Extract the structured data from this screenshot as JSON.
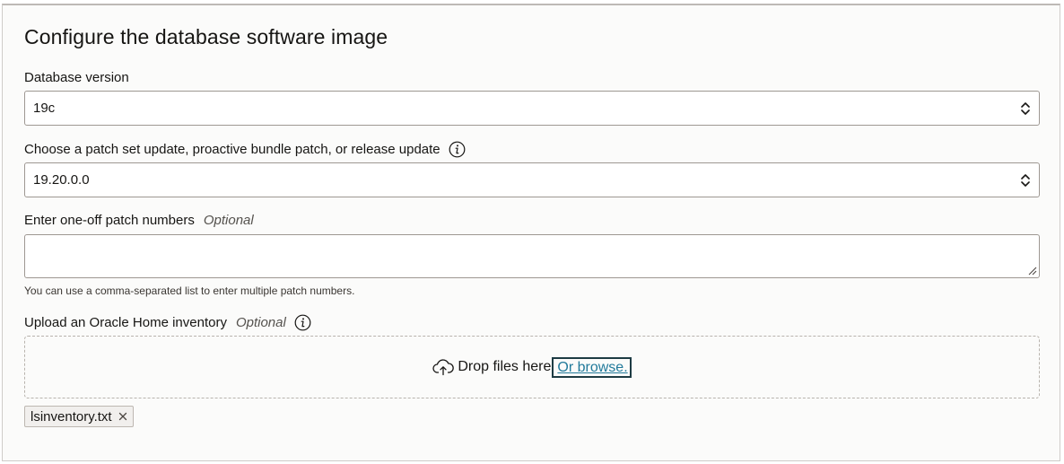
{
  "page": {
    "title": "Configure the database software image"
  },
  "fields": {
    "db_version": {
      "label": "Database version",
      "value": "19c"
    },
    "patch_update": {
      "label": "Choose a patch set update, proactive bundle patch, or release update",
      "value": "19.20.0.0"
    },
    "one_off": {
      "label": "Enter one-off patch numbers",
      "optional": "Optional",
      "value": "",
      "help": "You can use a comma-separated list to enter multiple patch numbers."
    },
    "inventory": {
      "label": "Upload an Oracle Home inventory",
      "optional": "Optional",
      "drop_text": "Drop files here",
      "browse_text": "Or browse.",
      "files": [
        "lsinventory.txt"
      ]
    }
  },
  "colors": {
    "link": "#227a9b",
    "border": "#9e9892",
    "panel_bg": "#fbfbfa"
  },
  "icons": [
    "info-icon",
    "chevron-up-down-icon",
    "cloud-upload-icon",
    "close-icon",
    "resize-grip-icon"
  ]
}
